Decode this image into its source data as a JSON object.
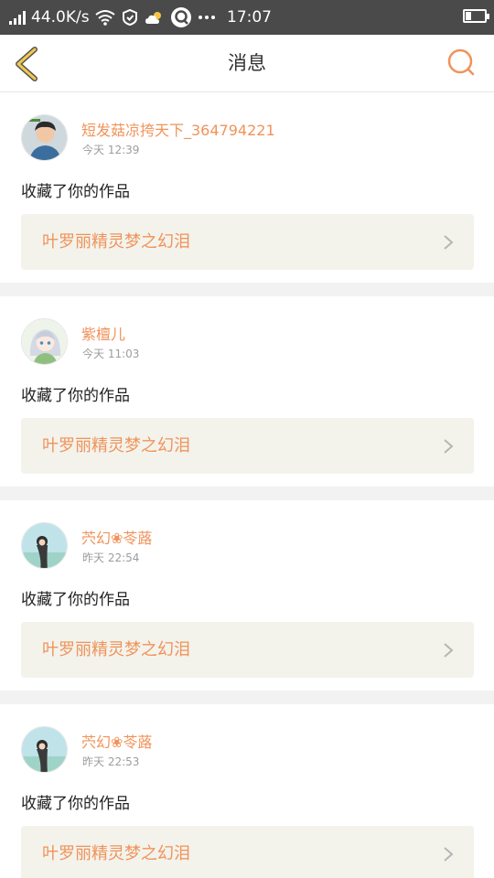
{
  "status_bar": {
    "speed": "44.0K/s",
    "time": "17:07",
    "icons": [
      "signal-icon",
      "wifi-icon",
      "sync-icon",
      "weather-icon",
      "app-icon",
      "more-icon",
      "battery-icon"
    ]
  },
  "header": {
    "title": "消息",
    "back_icon": "chevron-left-icon",
    "search_icon": "search-icon"
  },
  "colors": {
    "accent": "#f0935a",
    "back": "#f2c94c",
    "card_link_bg": "#f3f3ec"
  },
  "messages": [
    {
      "user": "短发菇凉挎天下_364794221",
      "time": "今天 12:39",
      "action": "收藏了你的作品",
      "work": "叶罗丽精灵梦之幻泪"
    },
    {
      "user": "紫檀儿",
      "time": "今天 11:03",
      "action": "收藏了你的作品",
      "work": "叶罗丽精灵梦之幻泪"
    },
    {
      "user": "茓幻❀苓蕗",
      "time": "昨天 22:54",
      "action": "收藏了你的作品",
      "work": "叶罗丽精灵梦之幻泪"
    },
    {
      "user": "茓幻❀苓蕗",
      "time": "昨天 22:53",
      "action": "收藏了你的作品",
      "work": "叶罗丽精灵梦之幻泪"
    }
  ]
}
